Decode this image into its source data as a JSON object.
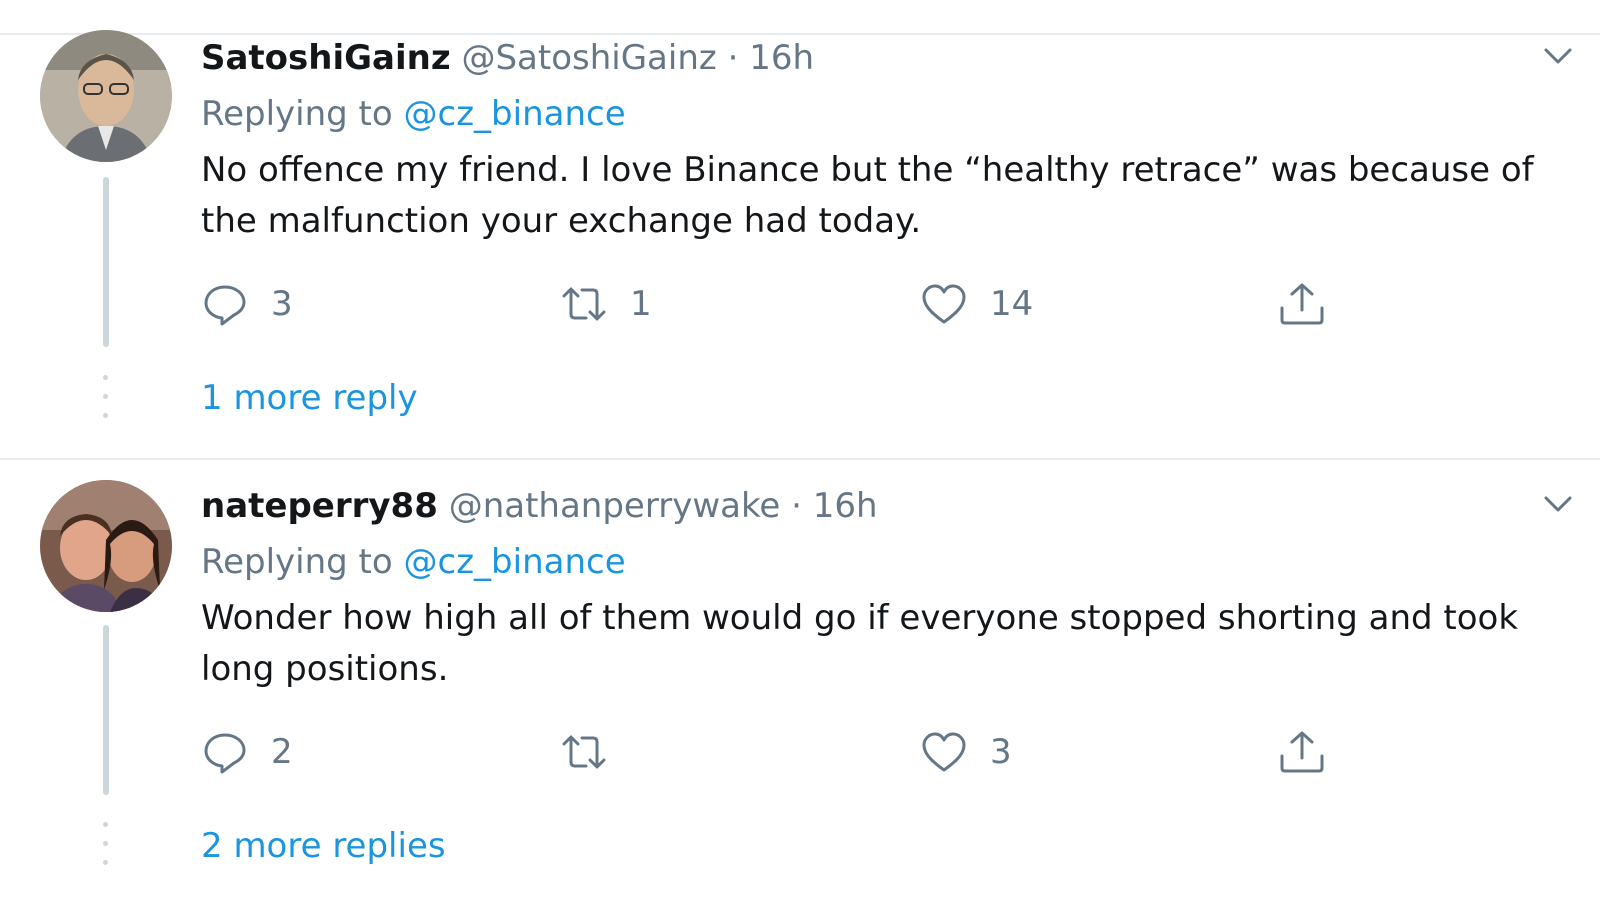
{
  "tweets": [
    {
      "display_name": "SatoshiGainz",
      "handle": "@SatoshiGainz",
      "separator": "·",
      "time": "16h",
      "replying_prefix": "Replying to",
      "replying_to": "@cz_binance",
      "text": "No offence my friend. I love Binance but the “healthy retrace” was because of the malfunction your exchange had today.",
      "reply_count": "3",
      "retweet_count": "1",
      "like_count": "14",
      "more_replies": "1 more reply"
    },
    {
      "display_name": "nateperry88",
      "handle": "@nathanperrywake",
      "separator": "·",
      "time": "16h",
      "replying_prefix": "Replying to",
      "replying_to": "@cz_binance",
      "text": "Wonder how high all of them would go if everyone stopped shorting and took long positions.",
      "reply_count": "2",
      "retweet_count": "",
      "like_count": "3",
      "more_replies": "2 more replies"
    }
  ],
  "colors": {
    "mention": "#1b95e0",
    "secondary_text": "#657786",
    "primary_text": "#14171a",
    "divider": "#e6ecf0",
    "thread_line": "#ccd6dd"
  },
  "icons": {
    "reply": "speech-bubble-icon",
    "retweet": "retweet-arrows-icon",
    "like": "heart-icon",
    "share": "share-upload-icon",
    "menu": "chevron-down-icon"
  }
}
